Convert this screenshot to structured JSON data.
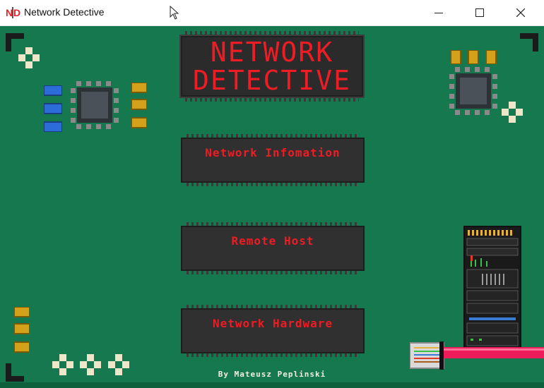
{
  "window": {
    "title": "Network Detective",
    "app_icon_text": "ND",
    "minimize_label": "minimize",
    "maximize_label": "maximize",
    "close_label": "close"
  },
  "header": {
    "line1": "NETWORK",
    "line2": "DETECTIVE"
  },
  "menu": {
    "items": [
      {
        "label": "Network Infomation"
      },
      {
        "label": "Remote Host"
      },
      {
        "label": "Network Hardware"
      }
    ]
  },
  "footer": {
    "credit": "By Mateusz Peplinski"
  },
  "colors": {
    "board": "#16784e",
    "accent_red": "#ee1c24",
    "chip": "#2b2b2b"
  }
}
